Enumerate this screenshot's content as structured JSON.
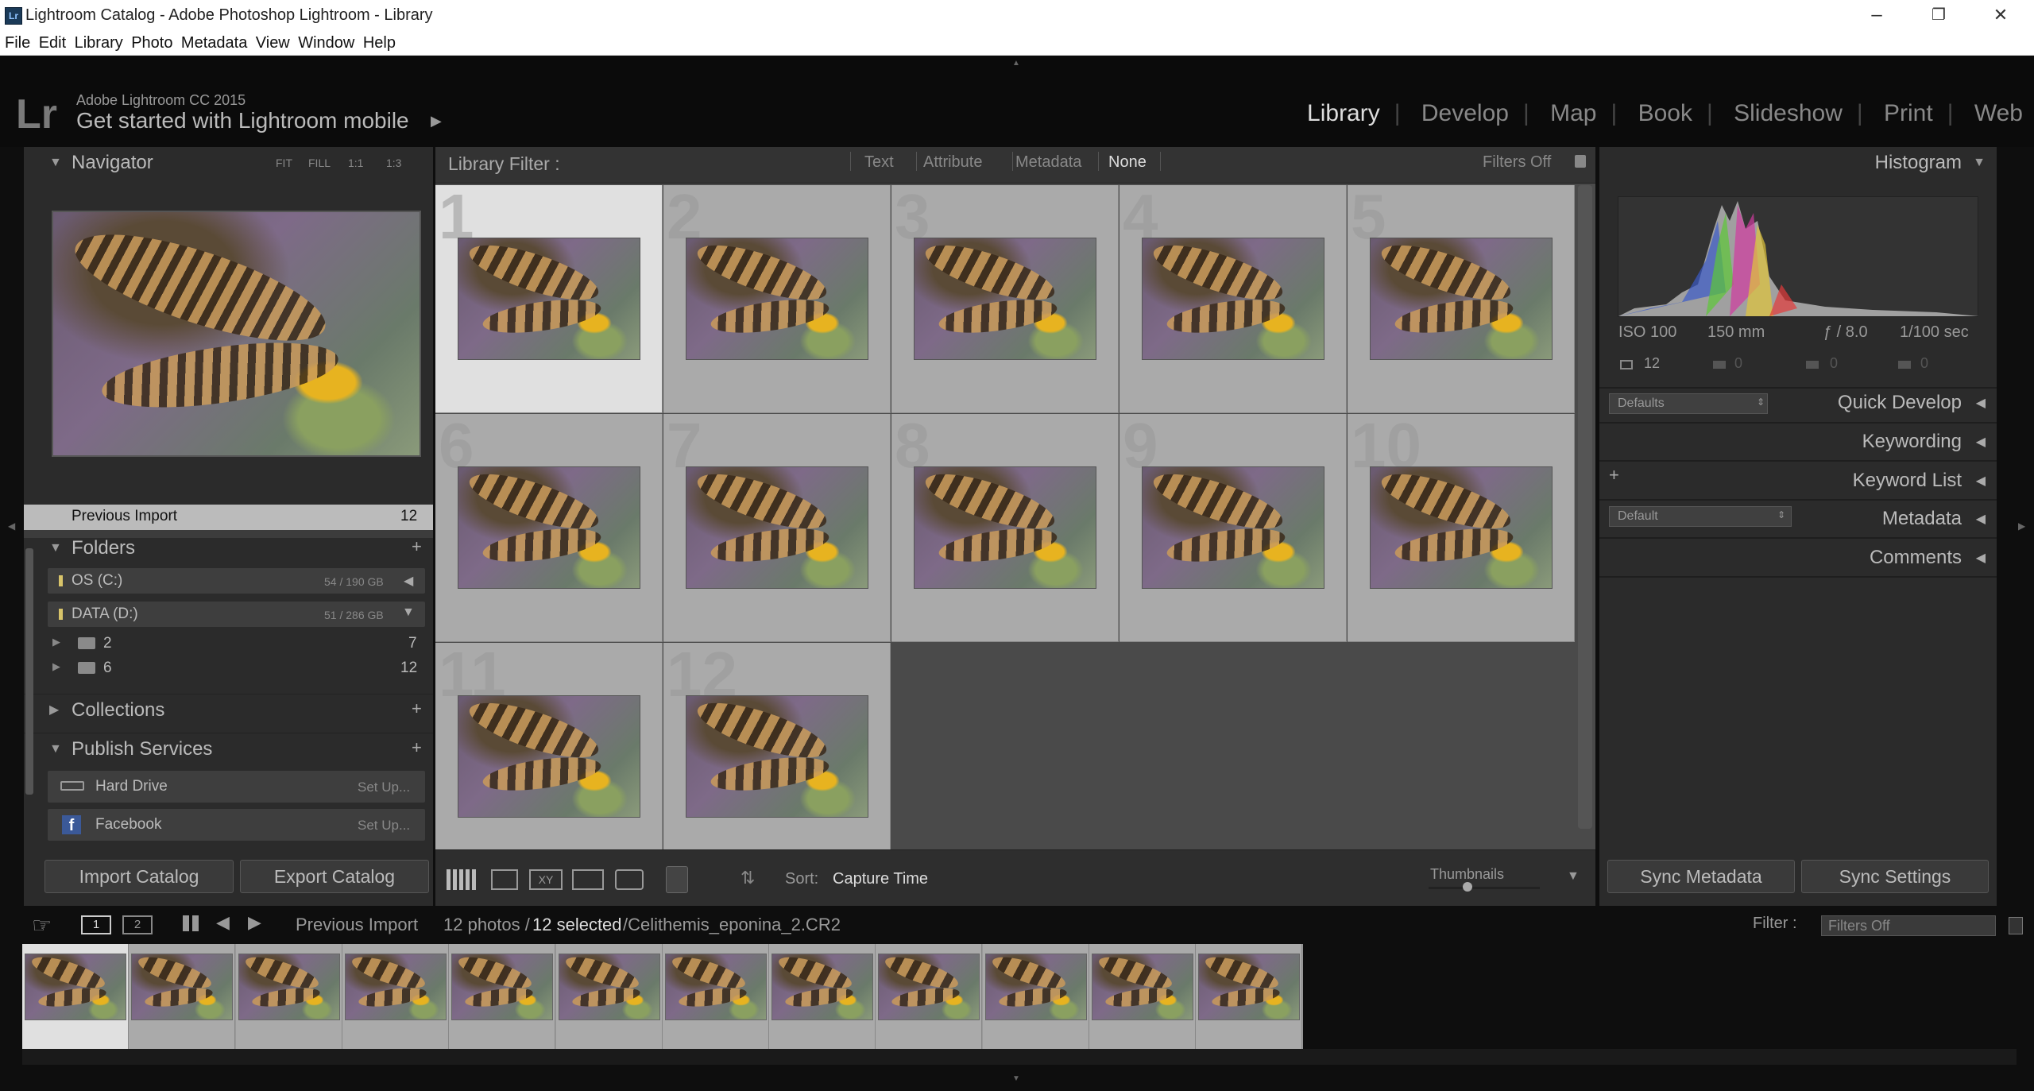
{
  "window": {
    "title": "Lightroom Catalog - Adobe Photoshop Lightroom - Library",
    "logo": "Lr",
    "controls": [
      "–",
      "❐",
      "✕"
    ]
  },
  "menu": [
    "File",
    "Edit",
    "Library",
    "Photo",
    "Metadata",
    "View",
    "Window",
    "Help"
  ],
  "identity": {
    "logo": "Lr",
    "product": "Adobe Lightroom CC 2015",
    "mobile": "Get started with Lightroom mobile",
    "arrow": "▶"
  },
  "modules": [
    {
      "label": "Library",
      "active": true
    },
    {
      "label": "Develop"
    },
    {
      "label": "Map"
    },
    {
      "label": "Book"
    },
    {
      "label": "Slideshow"
    },
    {
      "label": "Print"
    },
    {
      "label": "Web"
    }
  ],
  "navigator": {
    "title": "Navigator",
    "zoom": [
      "FIT",
      "FILL",
      "1:1",
      "1:3"
    ]
  },
  "catalog": {
    "label": "Previous Import",
    "count": "12"
  },
  "folders": {
    "title": "Folders",
    "volumes": [
      {
        "name": "OS (C:)",
        "size": "54 / 190 GB"
      },
      {
        "name": "DATA (D:)",
        "size": "51 / 286 GB"
      }
    ],
    "items": [
      {
        "name": "2",
        "count": "7"
      },
      {
        "name": "6",
        "count": "12"
      }
    ]
  },
  "collections": {
    "title": "Collections"
  },
  "publish": {
    "title": "Publish Services",
    "services": [
      {
        "name": "Hard Drive",
        "action": "Set Up..."
      },
      {
        "name": "Facebook",
        "action": "Set Up..."
      }
    ]
  },
  "left_buttons": {
    "import": "Import Catalog",
    "export": "Export Catalog"
  },
  "filter_bar": {
    "label": "Library Filter :",
    "options": [
      "Text",
      "Attribute",
      "Metadata",
      "None"
    ],
    "status": "Filters Off"
  },
  "grid": {
    "numbers": [
      "1",
      "2",
      "3",
      "4",
      "5",
      "6",
      "7",
      "8",
      "9",
      "10",
      "11",
      "12"
    ]
  },
  "toolbar": {
    "sort_label": "Sort:",
    "sort_value": "Capture Time",
    "thumbnails_label": "Thumbnails",
    "thumbnail_size": 0.35
  },
  "histogram": {
    "title": "Histogram",
    "iso": "ISO 100",
    "focal": "150 mm",
    "aperture": "ƒ / 8.0",
    "shutter": "1/100 sec",
    "count": "12",
    "zero1": "0",
    "zero2": "0",
    "zero3": "0"
  },
  "right_panels": {
    "quick_develop": "Quick Develop",
    "defaults": "Defaults",
    "keywording": "Keywording",
    "keyword_list": "Keyword List",
    "metadata": "Metadata",
    "default": "Default",
    "comments": "Comments"
  },
  "right_buttons": {
    "sync_metadata": "Sync Metadata",
    "sync_settings": "Sync Settings"
  },
  "filmstrip_bar": {
    "page1": "1",
    "page2": "2",
    "source": "Previous Import",
    "count": "12 photos /",
    "selected": "12 selected",
    "file": "/Celithemis_eponina_2.CR2",
    "filter_label": "Filter :",
    "filter_value": "Filters Off"
  },
  "icon_names": [
    "search-icon",
    "grid-view-icon",
    "loupe-view-icon",
    "compare-view-icon",
    "survey-view-icon",
    "people-view-icon",
    "spray-can-icon",
    "sort-az-icon",
    "lock-icon",
    "facebook-icon",
    "hard-drive-icon"
  ]
}
